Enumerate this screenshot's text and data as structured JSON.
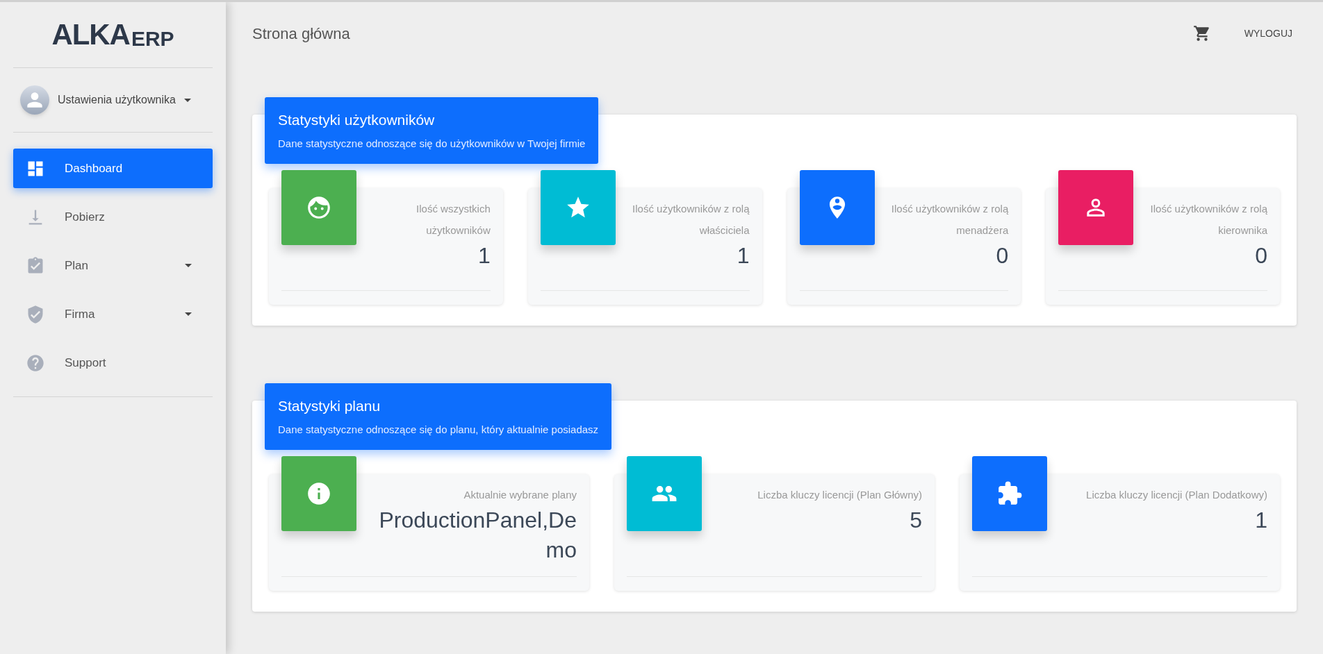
{
  "sidebar": {
    "logo": {
      "main": "ALKA",
      "suffix": "ERP"
    },
    "user_menu": {
      "label": "Ustawienia użytkownika"
    },
    "items": [
      {
        "label": "Dashboard",
        "selected": true,
        "has_submenu": false
      },
      {
        "label": "Pobierz",
        "selected": false,
        "has_submenu": false
      },
      {
        "label": "Plan",
        "selected": false,
        "has_submenu": true
      },
      {
        "label": "Firma",
        "selected": false,
        "has_submenu": true
      },
      {
        "label": "Support",
        "selected": false,
        "has_submenu": false
      }
    ]
  },
  "header": {
    "title": "Strona główna",
    "logout": "WYLOGUJ"
  },
  "sections": [
    {
      "title": "Statystyki użytkowników",
      "subtitle": "Dane statystyczne odnoszące się do użytkowników w Twojej firmie",
      "stats": [
        {
          "label": "Ilość wszystkich użytkowników",
          "value": "1",
          "color": "#4caf50"
        },
        {
          "label": "Ilość użytkowników z rolą właściciela",
          "value": "1",
          "color": "#00bcd4"
        },
        {
          "label": "Ilość użytkowników z rolą menadżera",
          "value": "0",
          "color": "#0d6efd"
        },
        {
          "label": "Ilość użytkowników z rolą kierownika",
          "value": "0",
          "color": "#e91e63"
        }
      ]
    },
    {
      "title": "Statystyki planu",
      "subtitle": "Dane statystyczne odnoszące się do planu, który aktualnie posiadasz",
      "stats": [
        {
          "label": "Aktualnie wybrane plany",
          "value": "ProductionPanel,Demo",
          "color": "#4caf50"
        },
        {
          "label": "Liczba kluczy licencji (Plan Główny)",
          "value": "5",
          "color": "#00bcd4"
        },
        {
          "label": "Liczba kluczy licencji (Plan Dodatkowy)",
          "value": "1",
          "color": "#0d6efd"
        }
      ]
    }
  ]
}
